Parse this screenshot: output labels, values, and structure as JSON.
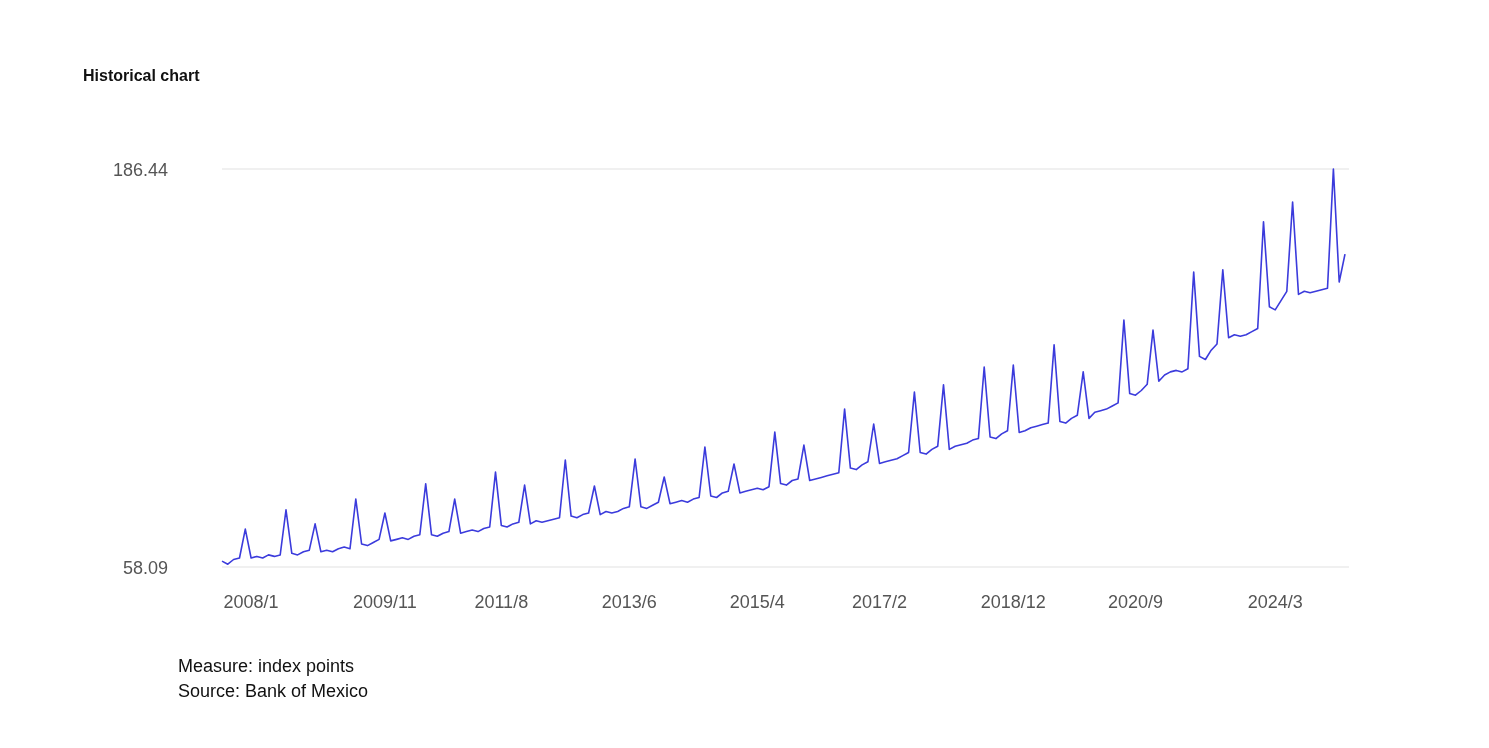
{
  "title": "Historical chart",
  "chart_data": {
    "type": "line",
    "ylim": [
      58.09,
      186.44
    ],
    "yticks": [
      58.09,
      186.44
    ],
    "categories": [
      null,
      null,
      null,
      null,
      null,
      "2008/1",
      null,
      null,
      null,
      null,
      null,
      null,
      null,
      null,
      null,
      null,
      null,
      null,
      null,
      null,
      null,
      null,
      null,
      null,
      null,
      null,
      null,
      null,
      "2009/11",
      null,
      null,
      null,
      null,
      null,
      null,
      null,
      null,
      null,
      null,
      null,
      null,
      null,
      null,
      null,
      null,
      null,
      null,
      null,
      "2011/8",
      null,
      null,
      null,
      null,
      null,
      null,
      null,
      null,
      null,
      null,
      null,
      null,
      null,
      null,
      null,
      null,
      null,
      null,
      null,
      null,
      null,
      "2013/6",
      null,
      null,
      null,
      null,
      null,
      null,
      null,
      null,
      null,
      null,
      null,
      null,
      null,
      null,
      null,
      null,
      null,
      null,
      null,
      null,
      null,
      "2015/4",
      null,
      null,
      null,
      null,
      null,
      null,
      null,
      null,
      null,
      null,
      null,
      null,
      null,
      null,
      null,
      null,
      null,
      null,
      null,
      null,
      "2017/2",
      null,
      null,
      null,
      null,
      null,
      null,
      null,
      null,
      null,
      null,
      null,
      null,
      null,
      null,
      null,
      null,
      null,
      null,
      null,
      null,
      null,
      null,
      "2018/12",
      null,
      null,
      null,
      null,
      null,
      null,
      null,
      null,
      null,
      null,
      null,
      null,
      null,
      null,
      null,
      null,
      null,
      null,
      null,
      null,
      "2020/9",
      null,
      null,
      null,
      null,
      null,
      null,
      null,
      null,
      null,
      null,
      null,
      null,
      null,
      null,
      null,
      null,
      null,
      null,
      null,
      null,
      null,
      null,
      null,
      "2024/3",
      null,
      null,
      null,
      null,
      null,
      null,
      null,
      null,
      null,
      null,
      null,
      null
    ],
    "values": [
      60,
      59,
      60.5,
      61,
      70.3,
      61,
      61.5,
      61,
      62,
      61.5,
      62,
      76.5,
      62.5,
      62,
      63,
      63.5,
      72,
      63,
      63.5,
      63,
      64,
      64.5,
      64,
      80,
      65.5,
      65,
      66,
      67,
      75.5,
      66.5,
      67,
      67.5,
      67,
      68,
      68.5,
      84.9,
      68.5,
      68,
      69,
      69.5,
      80,
      69,
      69.5,
      70,
      69.5,
      70.5,
      71,
      88.7,
      71.5,
      71,
      72,
      72.5,
      84.5,
      72,
      73,
      72.5,
      73,
      73.5,
      74,
      92.6,
      74.5,
      74,
      75,
      75.5,
      84.2,
      75,
      76,
      75.5,
      76,
      77,
      77.5,
      92.9,
      77.5,
      77,
      78,
      79,
      87.1,
      78.5,
      79,
      79.5,
      79,
      80,
      80.5,
      96.8,
      81,
      80.5,
      82,
      82.5,
      91.3,
      82,
      82.5,
      83,
      83.5,
      83,
      84,
      101.6,
      85,
      84.5,
      86,
      86.5,
      97.4,
      86,
      86.5,
      87,
      87.5,
      88,
      88.5,
      109,
      90,
      89.5,
      91,
      92,
      104.2,
      91.5,
      92,
      92.5,
      93,
      94,
      95,
      114.5,
      95,
      94.5,
      96,
      97,
      116.8,
      96,
      97,
      97.5,
      98,
      99,
      99.5,
      122.6,
      100,
      99.5,
      101,
      102,
      123.2,
      101.5,
      102,
      103,
      103.5,
      104,
      104.5,
      129.7,
      105,
      104.5,
      106,
      107,
      121,
      106,
      108,
      108.5,
      109,
      110,
      111,
      137.7,
      114,
      113.5,
      115,
      117,
      134.5,
      118,
      120,
      121,
      121.5,
      121,
      122,
      153.2,
      126,
      125,
      128,
      130,
      153.9,
      132,
      133,
      132.5,
      133,
      134,
      135,
      169.4,
      142,
      141,
      144,
      147,
      175.8,
      146,
      147,
      146.5,
      147,
      147.5,
      148,
      186.44,
      150,
      159
    ]
  },
  "measure": "Measure: index points",
  "source": "Source: Bank of Mexico"
}
